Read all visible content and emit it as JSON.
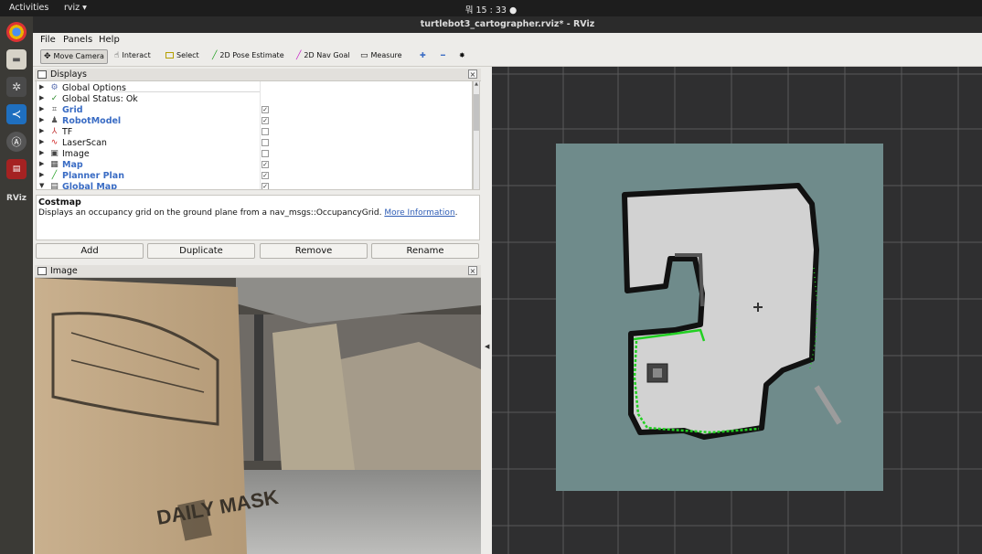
{
  "topbar": {
    "activities": "Activities",
    "app": "rviz ▾",
    "clock": "뭐 15 : 33 ●"
  },
  "window": {
    "title": "turtlebot3_cartographer.rviz* - RViz"
  },
  "menu": [
    "File",
    "Panels",
    "Help"
  ],
  "toolbar": [
    {
      "label": "Move Camera",
      "icon": "move-camera-icon"
    },
    {
      "label": "Interact",
      "icon": "hand-icon"
    },
    {
      "label": "Select",
      "icon": "select-icon"
    },
    {
      "label": "2D Pose Estimate",
      "icon": "green-arrow-icon"
    },
    {
      "label": "2D Nav Goal",
      "icon": "magenta-arrow-icon"
    },
    {
      "label": "Measure",
      "icon": "ruler-icon"
    }
  ],
  "displays": {
    "title": "Displays",
    "items": [
      {
        "name": "Global Options",
        "icon": "⚙",
        "checked": null,
        "blue": false,
        "color": "#555555"
      },
      {
        "name": "Global Status: Ok",
        "icon": "✓",
        "checked": null,
        "blue": false,
        "color": "#2e8b2e"
      },
      {
        "name": "Grid",
        "icon": "⌗",
        "checked": true,
        "blue": true,
        "color": "#555555"
      },
      {
        "name": "RobotModel",
        "icon": "♟",
        "checked": true,
        "blue": true,
        "color": "#555555"
      },
      {
        "name": "TF",
        "icon": "⅄",
        "checked": false,
        "blue": false,
        "color": "#c23a3a"
      },
      {
        "name": "LaserScan",
        "icon": "∿",
        "checked": false,
        "blue": false,
        "color": "#d02020"
      },
      {
        "name": "Image",
        "icon": "▣",
        "checked": false,
        "blue": false,
        "color": "#444444"
      },
      {
        "name": "Map",
        "icon": "▦",
        "checked": true,
        "blue": true,
        "color": "#444444"
      },
      {
        "name": "Planner Plan",
        "icon": "╱",
        "checked": true,
        "blue": true,
        "color": "#22a022"
      },
      {
        "name": "Global Map",
        "icon": "▤",
        "checked": true,
        "blue": true,
        "color": "#444444"
      }
    ]
  },
  "description": {
    "heading": "Costmap",
    "text": "Displays an occupancy grid on the ground plane from a nav_msgs::OccupancyGrid.",
    "link": "More Information"
  },
  "buttons": {
    "add": "Add",
    "duplicate": "Duplicate",
    "remove": "Remove",
    "rename": "Rename"
  },
  "image_panel": {
    "title": "Image",
    "box_text_1": "DAILY MASK"
  },
  "colors": {
    "map_free": "#d2d2d2",
    "map_unknown": "#6f8b8b",
    "wall": "#111111",
    "scan": "#22d022",
    "view_bg": "#2f2f30"
  }
}
